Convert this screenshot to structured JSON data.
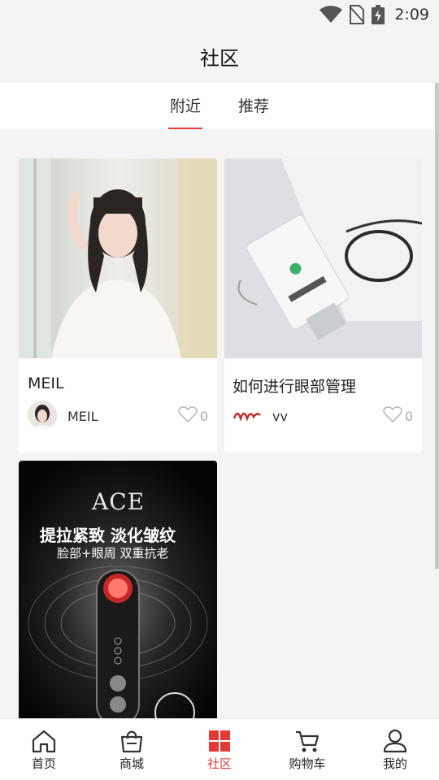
{
  "status_bar": {
    "time": "2:09",
    "icons": [
      "wifi-icon",
      "no-sim-icon",
      "battery-charging-icon"
    ]
  },
  "page_title": "社区",
  "tabs": [
    {
      "label": "附近",
      "active": true
    },
    {
      "label": "推荐",
      "active": false
    }
  ],
  "posts": [
    {
      "title": "MEIL",
      "author": "MEIL",
      "likes": "0",
      "image": "portrait-photo",
      "avatar": "portrait-avatar"
    },
    {
      "title": "如何进行眼部管理",
      "author": "vv",
      "likes": "0",
      "image": "cream-tube-photo",
      "avatar": "handwritten-logo-avatar"
    },
    {
      "title": "",
      "author": "",
      "likes": "",
      "image": "beauty-device-ad",
      "ad_text": {
        "brand": "ACE",
        "headline": "提拉紧致 淡化皱纹",
        "subline": "脸部+眼周 双重抗老"
      }
    }
  ],
  "bottom_nav": [
    {
      "label": "首页",
      "icon": "home-icon",
      "active": false
    },
    {
      "label": "商城",
      "icon": "shopping-bag-icon",
      "active": false
    },
    {
      "label": "社区",
      "icon": "community-grid-icon",
      "active": true
    },
    {
      "label": "购物车",
      "icon": "cart-icon",
      "active": false
    },
    {
      "label": "我的",
      "icon": "profile-icon",
      "active": false
    }
  ],
  "colors": {
    "accent": "#e53935",
    "background": "#f4f4f4",
    "card": "#ffffff",
    "muted": "#aaaaaa"
  }
}
